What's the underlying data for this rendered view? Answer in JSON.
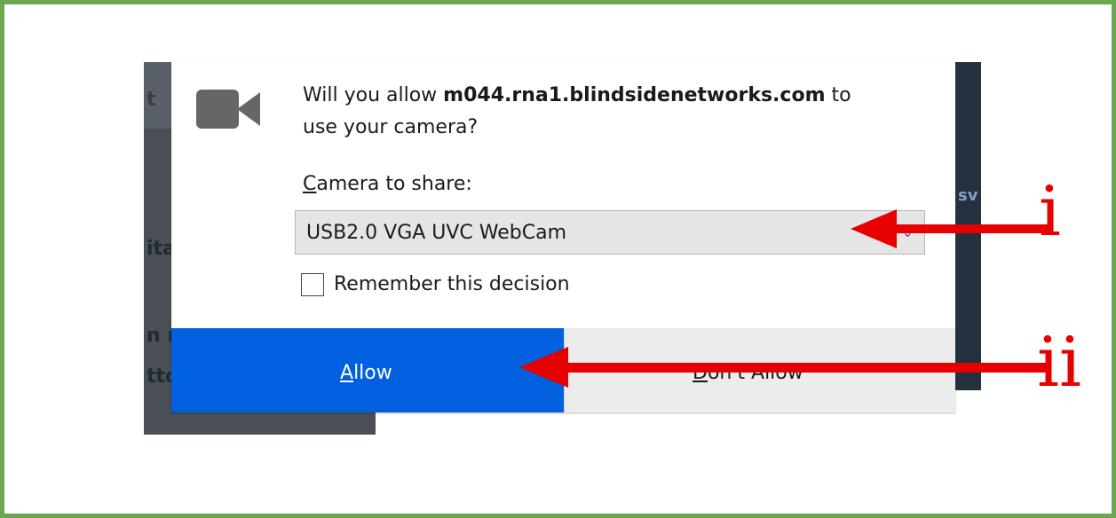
{
  "dialog": {
    "prompt_prefix": "Will you allow ",
    "prompt_host": "m044.rna1.blindsidenetworks.com",
    "prompt_suffix": " to",
    "prompt_line2": "use your camera?",
    "camera_label_first": "C",
    "camera_label_rest": "amera to share:",
    "selected_camera": "USB2.0 VGA UVC WebCam",
    "remember_label": "Remember this decision",
    "remember_checked": false,
    "allow_first": "A",
    "allow_rest": "llow",
    "deny_first": "D",
    "deny_rest": "on't Allow",
    "icon": "camera-icon"
  },
  "background": {
    "left_fragments": [
      "t",
      "ita",
      "n r",
      "tto"
    ],
    "right_fragment": "sv"
  },
  "annotations": {
    "arrow_i_label": "i",
    "arrow_ii_label": "ii",
    "color": "#e60000"
  },
  "colors": {
    "border": "#6aa84f",
    "allow_button": "#0060df",
    "deny_button": "#ececec"
  }
}
